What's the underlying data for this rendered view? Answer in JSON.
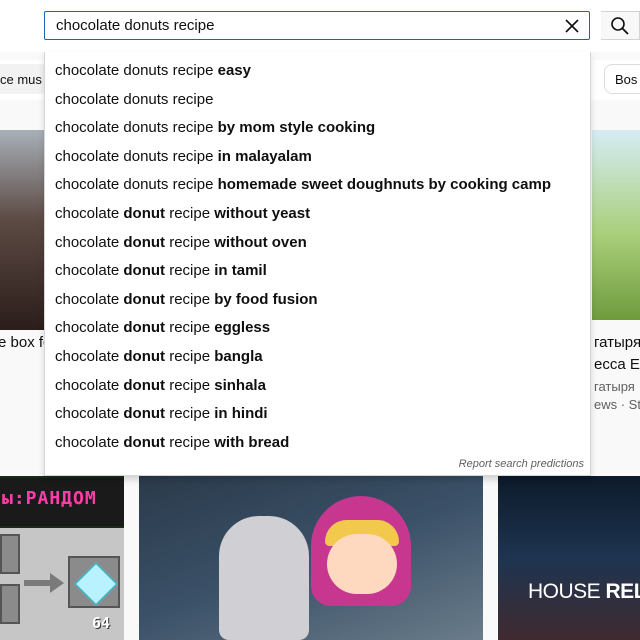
{
  "search": {
    "query": "chocolate donuts recipe"
  },
  "chips": {
    "left_label": "ce mus",
    "right_label": "Bos"
  },
  "suggestions": [
    {
      "parts": [
        {
          "t": "chocolate donuts recipe ",
          "b": false
        },
        {
          "t": "easy",
          "b": true
        }
      ]
    },
    {
      "parts": [
        {
          "t": "chocolate donuts recipe",
          "b": false
        }
      ]
    },
    {
      "parts": [
        {
          "t": "chocolate donuts recipe ",
          "b": false
        },
        {
          "t": "by mom style cooking",
          "b": true
        }
      ]
    },
    {
      "parts": [
        {
          "t": "chocolate donuts recipe ",
          "b": false
        },
        {
          "t": "in malayalam",
          "b": true
        }
      ]
    },
    {
      "parts": [
        {
          "t": "chocolate donuts recipe ",
          "b": false
        },
        {
          "t": "homemade sweet doughnuts by cooking camp",
          "b": true
        }
      ]
    },
    {
      "parts": [
        {
          "t": "chocolate ",
          "b": false
        },
        {
          "t": "donut",
          "b": true
        },
        {
          "t": " recipe ",
          "b": false
        },
        {
          "t": "without yeast",
          "b": true
        }
      ]
    },
    {
      "parts": [
        {
          "t": "chocolate ",
          "b": false
        },
        {
          "t": "donut",
          "b": true
        },
        {
          "t": " recipe ",
          "b": false
        },
        {
          "t": "without oven",
          "b": true
        }
      ]
    },
    {
      "parts": [
        {
          "t": "chocolate ",
          "b": false
        },
        {
          "t": "donut",
          "b": true
        },
        {
          "t": " recipe ",
          "b": false
        },
        {
          "t": "in tamil",
          "b": true
        }
      ]
    },
    {
      "parts": [
        {
          "t": "chocolate ",
          "b": false
        },
        {
          "t": "donut",
          "b": true
        },
        {
          "t": " recipe ",
          "b": false
        },
        {
          "t": "by food fusion",
          "b": true
        }
      ]
    },
    {
      "parts": [
        {
          "t": "chocolate ",
          "b": false
        },
        {
          "t": "donut",
          "b": true
        },
        {
          "t": " recipe ",
          "b": false
        },
        {
          "t": "eggless",
          "b": true
        }
      ]
    },
    {
      "parts": [
        {
          "t": "chocolate ",
          "b": false
        },
        {
          "t": "donut",
          "b": true
        },
        {
          "t": " recipe ",
          "b": false
        },
        {
          "t": "bangla",
          "b": true
        }
      ]
    },
    {
      "parts": [
        {
          "t": "chocolate ",
          "b": false
        },
        {
          "t": "donut",
          "b": true
        },
        {
          "t": " recipe ",
          "b": false
        },
        {
          "t": "sinhala",
          "b": true
        }
      ]
    },
    {
      "parts": [
        {
          "t": "chocolate ",
          "b": false
        },
        {
          "t": "donut",
          "b": true
        },
        {
          "t": " recipe ",
          "b": false
        },
        {
          "t": "in hindi",
          "b": true
        }
      ]
    },
    {
      "parts": [
        {
          "t": "chocolate ",
          "b": false
        },
        {
          "t": "donut",
          "b": true
        },
        {
          "t": " recipe ",
          "b": false
        },
        {
          "t": "with bread",
          "b": true
        }
      ]
    }
  ],
  "report_label": "Report search predictions",
  "background_videos": {
    "left_title_fragment": "e box fc",
    "right_title_line1": "гатыря",
    "right_title_line2": "есса Er",
    "right_channel": "гатыря",
    "right_meta": "ews · Str",
    "rand_banner": "ы:РАНДОМ",
    "item_count": "64",
    "house_text_light": "HOUSE ",
    "house_text_bold": "RELA"
  },
  "icons": {
    "clear": "close-icon",
    "search": "search-icon"
  },
  "colors": {
    "search_border": "#1c62b9",
    "text": "#0f0f0f",
    "muted": "#606060"
  }
}
